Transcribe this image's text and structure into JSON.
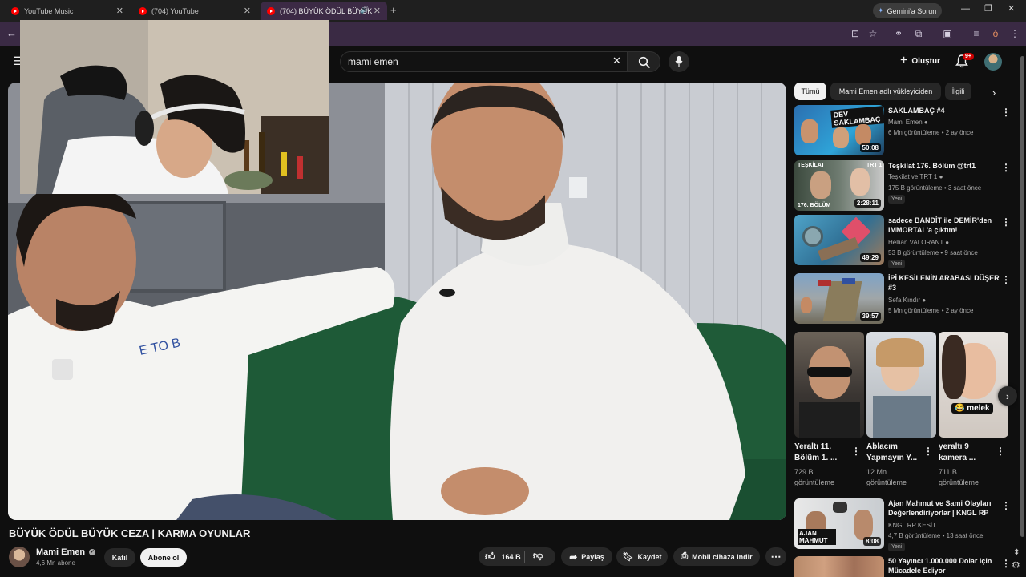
{
  "browser": {
    "tabs": [
      {
        "label": "YouTube Music"
      },
      {
        "label": "(704) YouTube"
      },
      {
        "label": "(704) BÜYÜK ÖDÜL BÜYÜK"
      }
    ],
    "gemini_label": "Gemini'a Sorun"
  },
  "youtube": {
    "search_value": "mami emen",
    "create_label": "Oluştur",
    "notification_count": "9+"
  },
  "video": {
    "title": "BÜYÜK ÖDÜL BÜYÜK CEZA | KARMA OYUNLAR",
    "channel": "Mami Emen",
    "subscribers": "4,6 Mn abone",
    "join_label": "Katıl",
    "subscribe_label": "Abone ol",
    "likes": "164 B",
    "share_label": "Paylaş",
    "save_label": "Kaydet",
    "download_label": "Mobil cihaza indir"
  },
  "chips": [
    "Tümü",
    "Mami Emen adlı yükleyiciden",
    "İlgili"
  ],
  "recommendations": [
    {
      "title": "SAKLAMBAÇ #4",
      "channel": "Mami Emen",
      "meta": "6 Mn görüntüleme • 2 ay önce",
      "duration": "50:08",
      "badge": "",
      "thumb_text": "DEV SAKLAMBAÇ"
    },
    {
      "title": "Teşkilat 176. Bölüm @trt1",
      "channel": "Teşkilat ve TRT 1",
      "meta": "175 B görüntüleme • 3 saat önce",
      "duration": "2:28:11",
      "badge": "Yeni",
      "thumb_text": "176. BÖLÜM"
    },
    {
      "title": "sadece BANDİT ile DEMİR'den IMMORTAL'a çıktım!",
      "channel": "Hellian VALORANT",
      "meta": "53 B görüntüleme • 9 saat önce",
      "duration": "49:29",
      "badge": "Yeni",
      "thumb_text": ""
    },
    {
      "title": "İPİ KESİLENİN ARABASI DÜŞER #3",
      "channel": "Sefa Kındır",
      "meta": "5 Mn görüntüleme • 2 ay önce",
      "duration": "39:57",
      "badge": "",
      "thumb_text": ""
    }
  ],
  "shorts": [
    {
      "title": "Yeraltı 11. Bölüm 1. ...",
      "views": "729 B görüntüleme",
      "caption": ""
    },
    {
      "title": "Ablacım Yapmayın Y...",
      "views": "12 Mn görüntüleme",
      "caption": ""
    },
    {
      "title": "yeraltı 9 kamera ...",
      "views": "711 B görüntüleme",
      "caption": "😂 melek"
    }
  ],
  "more_recommendations": [
    {
      "title": "Ajan Mahmut ve Sami Olayları Değerlendiriyorlar | KNGL RP",
      "channel": "KNGL RP KESİT",
      "meta": "4,7 B görüntüleme • 13 saat önce",
      "duration": "8:08",
      "badge": "Yeni",
      "thumb_text": "AJAN MAHMUT"
    },
    {
      "title": "50 Yayıncı 1.000.000 Dolar için Mücadele Ediyor",
      "channel": "",
      "meta": "",
      "duration": "",
      "badge": "",
      "thumb_text": ""
    }
  ]
}
